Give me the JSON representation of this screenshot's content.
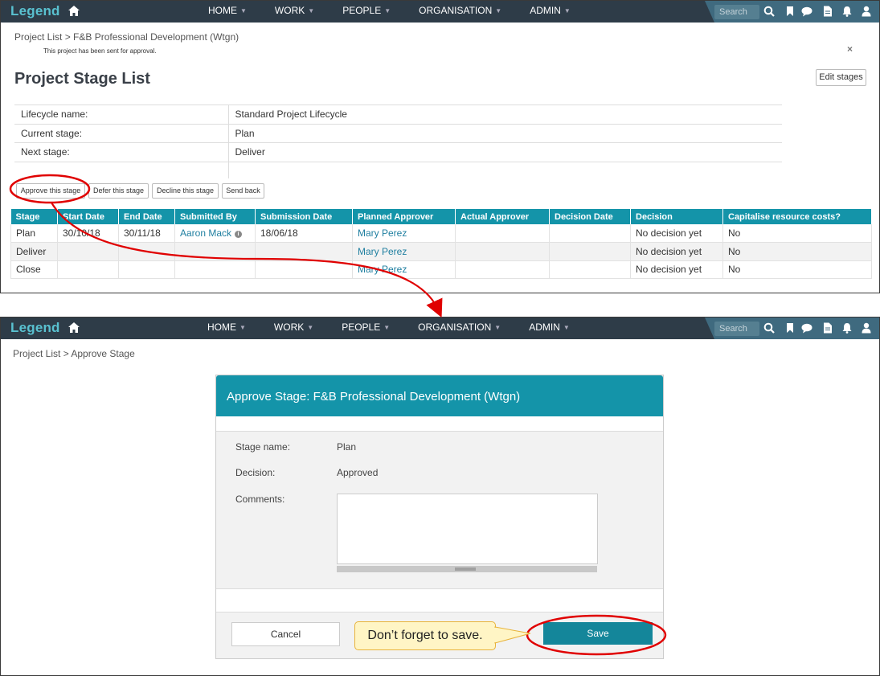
{
  "brand": {
    "logo_text": "Legend"
  },
  "nav": {
    "items": [
      "HOME",
      "WORK",
      "PEOPLE",
      "ORGANISATION",
      "ADMIN"
    ],
    "search_placeholder": "Search"
  },
  "panel1": {
    "breadcrumb": "Project List > F&B Professional Development (Wtgn)",
    "notice": "This project has been sent for approval.",
    "close_symbol": "×",
    "page_title": "Project Stage List",
    "edit_stages_label": "Edit stages",
    "info": [
      {
        "label": "Lifecycle name:",
        "value": "Standard Project Lifecycle"
      },
      {
        "label": "Current stage:",
        "value": "Plan"
      },
      {
        "label": "Next stage:",
        "value": "Deliver"
      },
      {
        "label": "",
        "value": ""
      }
    ],
    "actions": [
      "Approve this stage",
      "Defer this stage",
      "Decline this stage",
      "Send back"
    ],
    "table": {
      "headers": [
        "Stage",
        "Start Date",
        "End Date",
        "Submitted By",
        "Submission Date",
        "Planned Approver",
        "Actual Approver",
        "Decision Date",
        "Decision",
        "Capitalise resource costs?"
      ],
      "rows": [
        [
          "Plan",
          "30/10/18",
          "30/11/18",
          "Aaron Mack",
          "18/06/18",
          "Mary Perez",
          "",
          "",
          "No decision yet",
          "No"
        ],
        [
          "Deliver",
          "",
          "",
          "",
          "",
          "Mary Perez",
          "",
          "",
          "No decision yet",
          "No"
        ],
        [
          "Close",
          "",
          "",
          "",
          "",
          "Mary Perez",
          "",
          "",
          "No decision yet",
          "No"
        ]
      ]
    }
  },
  "panel2": {
    "breadcrumb": "Project List > Approve Stage",
    "modal": {
      "title": "Approve Stage: F&B Professional Development (Wtgn)",
      "stage_name_label": "Stage name:",
      "stage_name_value": "Plan",
      "decision_label": "Decision:",
      "decision_value": "Approved",
      "comments_label": "Comments:",
      "comments_value": "",
      "cancel_label": "Cancel",
      "save_label": "Save"
    }
  },
  "callout": {
    "text": "Don’t forget to save."
  },
  "colors": {
    "navbar": "#2e3c48",
    "accent": "#1494a9",
    "highlight": "#e00000",
    "callout_bg": "#fff5c5"
  }
}
